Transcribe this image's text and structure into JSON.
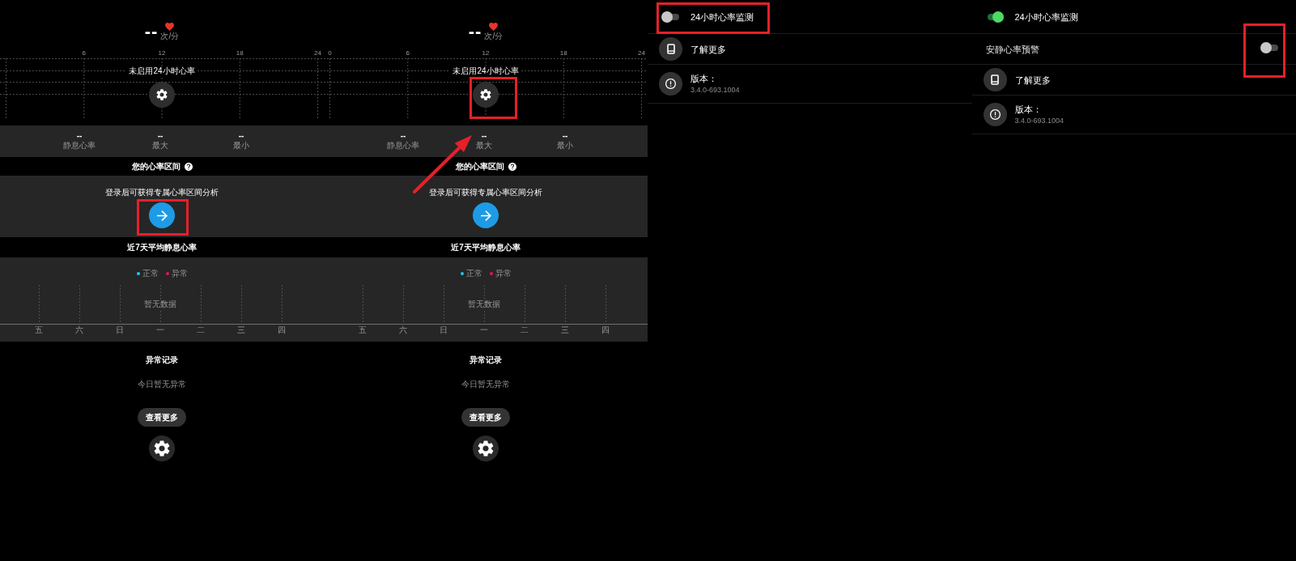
{
  "screens": [
    {
      "kind": "dashboard",
      "pointer_arrow": false,
      "current_rate": {
        "value": "--",
        "unit": "次/分"
      },
      "day_chart": {
        "hour_ticks": [
          "6",
          "12",
          "18",
          "24"
        ],
        "message": "未启用24小时心率",
        "settings_highlighted": false
      },
      "stats": [
        {
          "value": "--",
          "label": "静息心率"
        },
        {
          "value": "--",
          "label": "最大"
        },
        {
          "value": "--",
          "label": "最小"
        }
      ],
      "zone_section": {
        "title": "您的心率区间",
        "message": "登录后可获得专属心率区间分析",
        "next_highlighted": true
      },
      "week_section": {
        "title": "近7天平均静息心率",
        "legend": [
          {
            "label": "正常",
            "color": "#1ec8e6"
          },
          {
            "label": "异常",
            "color": "#e6174b"
          }
        ],
        "empty_text": "暂无数据",
        "days": [
          "五",
          "六",
          "日",
          "一",
          "二",
          "三",
          "四"
        ]
      },
      "abnormal_section": {
        "title": "异常记录",
        "message": "今日暂无异常",
        "more_button": "查看更多"
      }
    },
    {
      "kind": "dashboard",
      "pointer_arrow": true,
      "current_rate": {
        "value": "--",
        "unit": "次/分"
      },
      "day_chart": {
        "hour_ticks": [
          "0",
          "6",
          "12",
          "18",
          "24"
        ],
        "message": "未启用24小时心率",
        "settings_highlighted": true
      },
      "stats": [
        {
          "value": "--",
          "label": "静息心率"
        },
        {
          "value": "--",
          "label": "最大"
        },
        {
          "value": "--",
          "label": "最小"
        }
      ],
      "zone_section": {
        "title": "您的心率区间",
        "message": "登录后可获得专属心率区间分析",
        "next_highlighted": false
      },
      "week_section": {
        "title": "近7天平均静息心率",
        "legend": [
          {
            "label": "正常",
            "color": "#1ec8e6"
          },
          {
            "label": "异常",
            "color": "#e6174b"
          }
        ],
        "empty_text": "暂无数据",
        "days": [
          "五",
          "六",
          "日",
          "一",
          "二",
          "三",
          "四"
        ]
      },
      "abnormal_section": {
        "title": "异常记录",
        "message": "今日暂无异常",
        "more_button": "查看更多"
      }
    },
    {
      "kind": "settings",
      "rows": [
        {
          "kind": "toggle_left",
          "label": "24小时心率监测",
          "on": false,
          "highlighted": true
        },
        {
          "kind": "link",
          "label": "了解更多"
        },
        {
          "kind": "info",
          "label": "版本：",
          "value": "3.4.0-693.1004"
        }
      ]
    },
    {
      "kind": "settings",
      "rows": [
        {
          "kind": "toggle_left",
          "label": "24小时心率监测",
          "on": true,
          "highlighted": false
        },
        {
          "kind": "toggle_right",
          "label": "安静心率预警",
          "on": false,
          "highlighted": true
        },
        {
          "kind": "link",
          "label": "了解更多"
        },
        {
          "kind": "info",
          "label": "版本：",
          "value": "3.4.0-693.1004"
        }
      ]
    }
  ]
}
